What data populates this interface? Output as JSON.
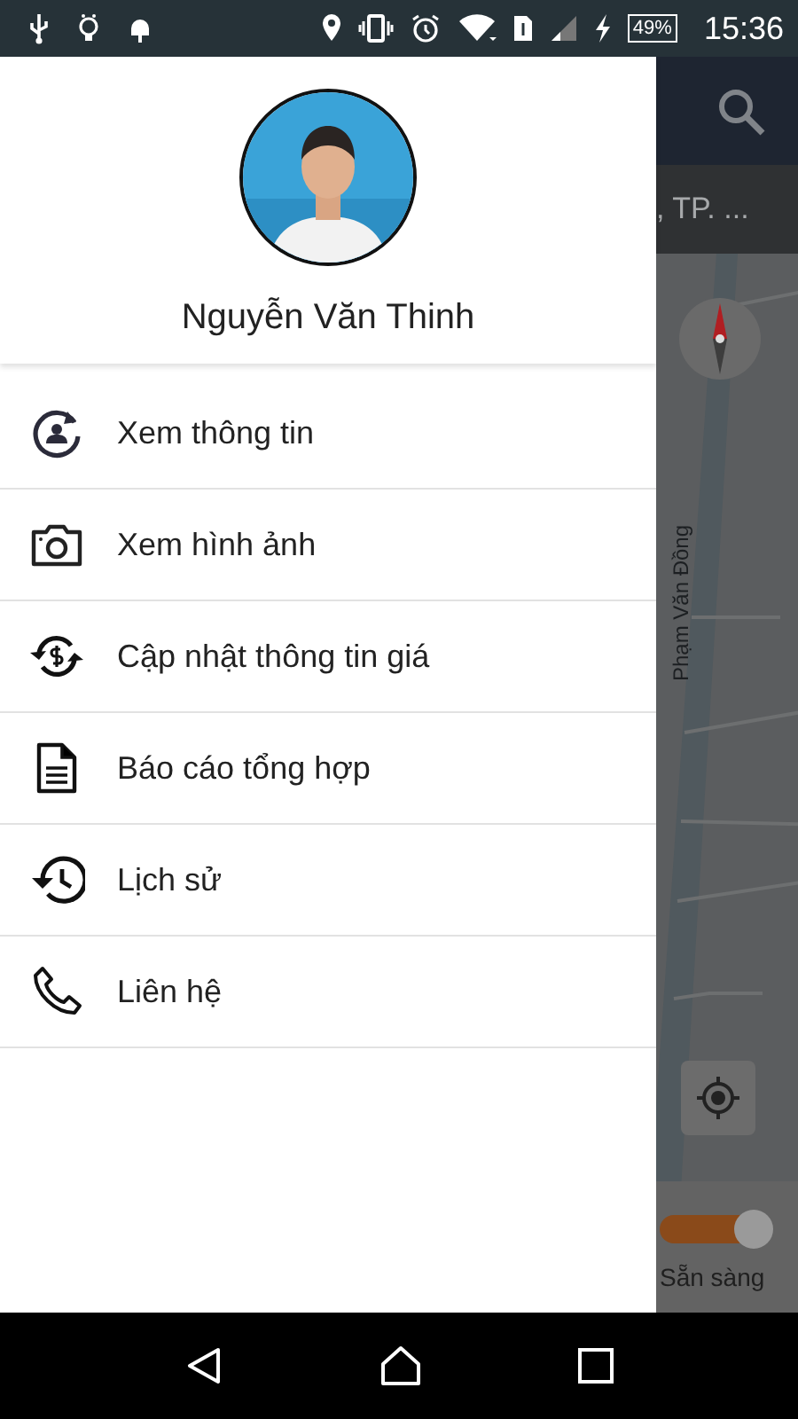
{
  "status_bar": {
    "battery": "49%",
    "time": "15:36"
  },
  "drawer": {
    "profile": {
      "name": "Nguyễn Văn Thinh"
    },
    "menu": [
      {
        "label": "Xem thông tin",
        "kind": "profile"
      },
      {
        "label": "Xem hình ảnh",
        "kind": "camera"
      },
      {
        "label": "Cập nhật thông tin giá",
        "kind": "price"
      },
      {
        "label": "Báo cáo tổng hợp",
        "kind": "report"
      },
      {
        "label": "Lịch sử",
        "kind": "history"
      },
      {
        "label": "Liên hệ",
        "kind": "phone"
      }
    ]
  },
  "background": {
    "address": ", TP. ...",
    "street": "Phạm Văn Đồng",
    "ready_switch": {
      "on": true,
      "label": "Sẵn sàng"
    }
  }
}
